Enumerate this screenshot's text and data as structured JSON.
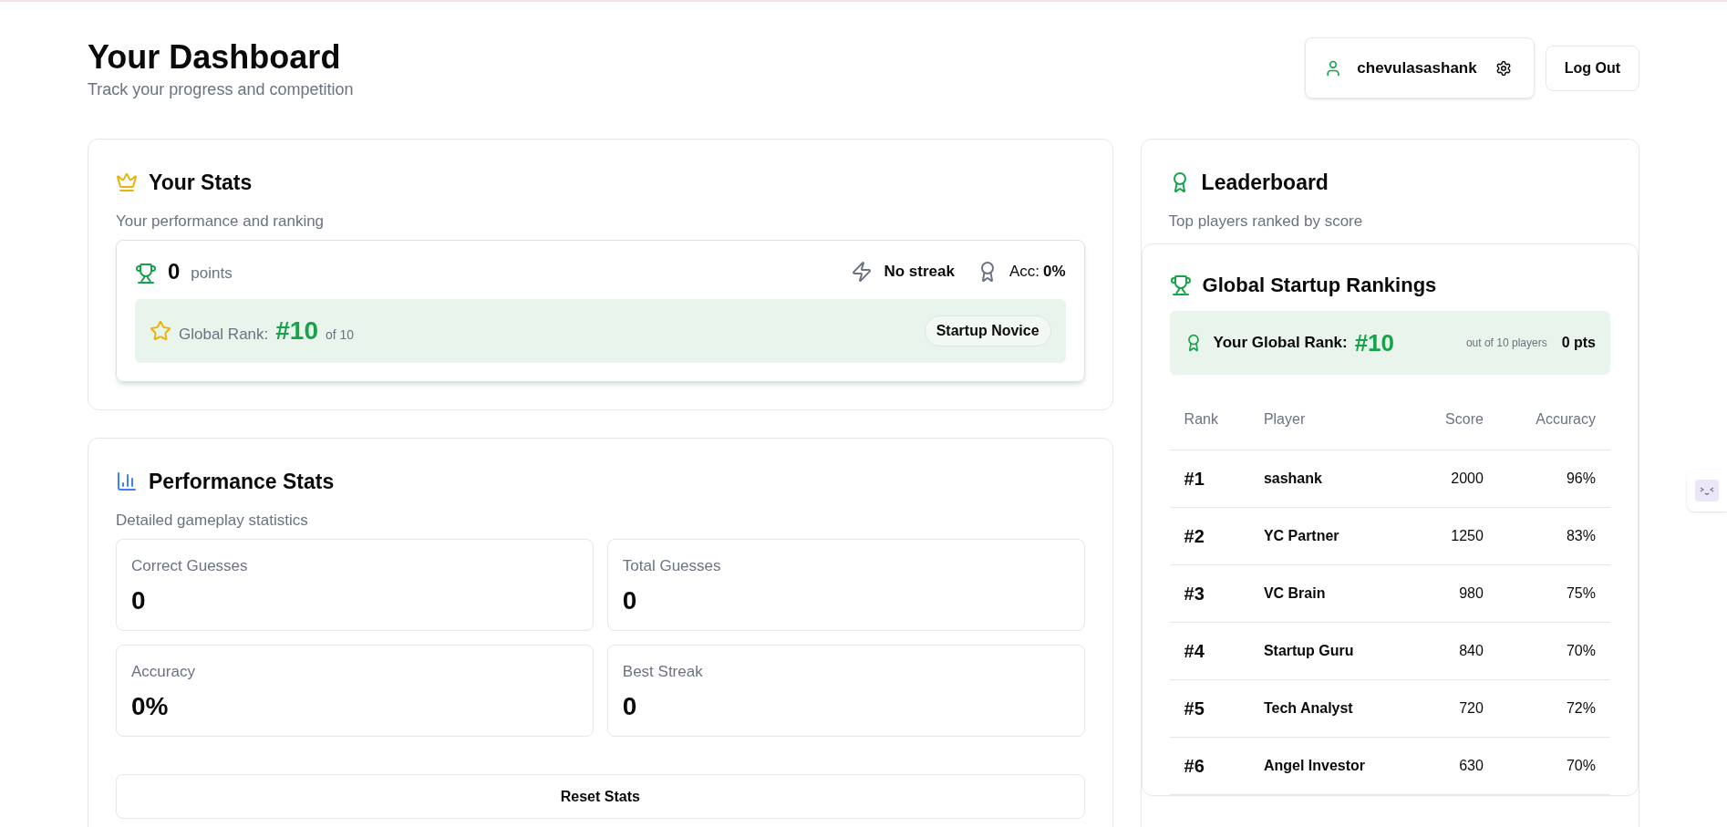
{
  "header": {
    "title": "Your Dashboard",
    "subtitle": "Track your progress and competition",
    "username": "chevulasashank",
    "logout": "Log Out"
  },
  "stats": {
    "title": "Your Stats",
    "subtitle": "Your performance and ranking",
    "points": "0",
    "points_label": "points",
    "streak": "No streak",
    "acc_label": "Acc:",
    "acc_value": "0%",
    "rank_label": "Global Rank:",
    "rank": "#10",
    "rank_of": "of 10",
    "badge": "Startup Novice"
  },
  "performance": {
    "title": "Performance Stats",
    "subtitle": "Detailed gameplay statistics",
    "tiles": [
      {
        "label": "Correct Guesses",
        "value": "0"
      },
      {
        "label": "Total Guesses",
        "value": "0"
      },
      {
        "label": "Accuracy",
        "value": "0%"
      },
      {
        "label": "Best Streak",
        "value": "0"
      }
    ],
    "reset": "Reset Stats"
  },
  "leaderboard": {
    "title": "Leaderboard",
    "subtitle": "Top players ranked by score",
    "global": {
      "title": "Global Startup Rankings",
      "rank_label": "Your Global Rank:",
      "rank": "#10",
      "out_of": "out of 10 players",
      "pts": "0 pts"
    },
    "columns": [
      "Rank",
      "Player",
      "Score",
      "Accuracy"
    ],
    "rows": [
      {
        "rank": "#1",
        "player": "sashank",
        "score": "2000",
        "accuracy": "96%"
      },
      {
        "rank": "#2",
        "player": "YC Partner",
        "score": "1250",
        "accuracy": "83%"
      },
      {
        "rank": "#3",
        "player": "VC Brain",
        "score": "980",
        "accuracy": "75%"
      },
      {
        "rank": "#4",
        "player": "Startup Guru",
        "score": "840",
        "accuracy": "70%"
      },
      {
        "rank": "#5",
        "player": "Tech Analyst",
        "score": "720",
        "accuracy": "72%"
      },
      {
        "rank": "#6",
        "player": "Angel Investor",
        "score": "630",
        "accuracy": "70%"
      }
    ]
  }
}
